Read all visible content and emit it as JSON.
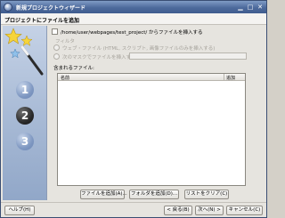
{
  "window": {
    "title": "新規プロジェクトウィザード"
  },
  "header": {
    "title": "プロジェクトにファイルを追加"
  },
  "options": {
    "insert_files_label": "/home/user/webpages/test_project/ からファイルを挿入する",
    "filter_group_label": "フィルタ",
    "filter_radio_1_label": "ウェブ・ファイル (HTML, スクリプト, 画像ファイルのみを挿入する)",
    "filter_radio_2_label": "次のマスクでファイルを挿入する"
  },
  "files": {
    "label": "含まれるファイル:",
    "columns": [
      "名前",
      "追加"
    ],
    "rows": []
  },
  "file_buttons": {
    "add_files": "ファイルを追加(A)...",
    "add_folder": "フォルダを追加(D)...",
    "clear_list": "リストをクリア(C)"
  },
  "nav_buttons": {
    "help": "ヘルプ(H)",
    "back": "< 戻る(B)",
    "next": "次へ(N) >",
    "cancel": "キャンセル(C)"
  },
  "steps": [
    "1",
    "2",
    "3"
  ],
  "icons": {
    "window": "wizard-app-icon",
    "sidebar": "magic-wand-stars-icon"
  },
  "colors": {
    "titlebar": "#4d6a9c",
    "sidebar": "#a9bbd6",
    "active_step": "#2a2a2a",
    "inactive_step": "#7f98c2"
  }
}
